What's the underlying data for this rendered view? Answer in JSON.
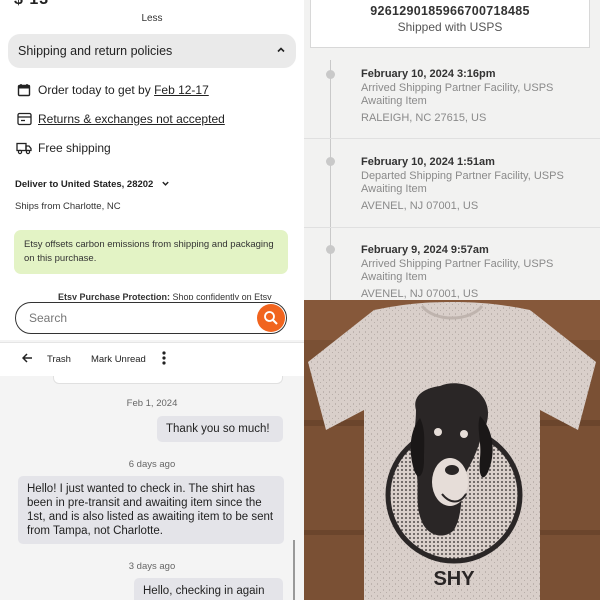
{
  "etsy": {
    "price_partial": "$ 13",
    "less_link": "Less",
    "policies_title": "Shipping and return policies",
    "order_text_prefix": "Order today to get by ",
    "order_dates": "Feb 12-17",
    "returns_text": "Returns & exchanges not accepted",
    "free_shipping": "Free shipping",
    "deliver_to": "Deliver to United States, 28202",
    "ships_from": "Ships from Charlotte, NC",
    "carbon_note": "Etsy offsets carbon emissions from shipping and packaging on this purchase.",
    "protection_bold": "Etsy Purchase Protection:",
    "protection_text": " Shop confidently on Etsy"
  },
  "tracking": {
    "number": "9261290185966700718485",
    "carrier": "Shipped with USPS",
    "events": [
      {
        "datetime": "February 10, 2024 3:16pm",
        "status": "Arrived Shipping Partner Facility, USPS Awaiting Item",
        "location": "RALEIGH, NC 27615, US"
      },
      {
        "datetime": "February 10, 2024 1:51am",
        "status": "Departed Shipping Partner Facility, USPS Awaiting Item",
        "location": "AVENEL, NJ 07001, US"
      },
      {
        "datetime": "February 9, 2024 9:57am",
        "status": "Arrived Shipping Partner Facility, USPS Awaiting Item",
        "location": "AVENEL, NJ 07001, US"
      }
    ]
  },
  "messages": {
    "search_placeholder": "Search",
    "toolbar": {
      "trash": "Trash",
      "mark_unread": "Mark Unread"
    },
    "thread": [
      {
        "date": "Feb 1, 2024",
        "text": "Thank you so much!"
      },
      {
        "date": "6 days ago",
        "text": "Hello! I just wanted to check in. The shirt has been in pre-transit and awaiting item since the 1st, and is also listed as awaiting item to be sent from Tampa, not Charlotte."
      },
      {
        "date": "3 days ago",
        "text": "Hello, checking in again"
      }
    ]
  },
  "photo": {
    "shirt_text": "SHY",
    "colors": {
      "background": "#7a5034",
      "shirt": "#d9cfca",
      "print": "#2a2626"
    }
  },
  "icons": [
    "calendar-icon",
    "returns-icon",
    "truck-icon",
    "chevron-up-icon",
    "chevron-down-icon",
    "search-icon",
    "back-arrow-icon",
    "more-vertical-icon"
  ]
}
